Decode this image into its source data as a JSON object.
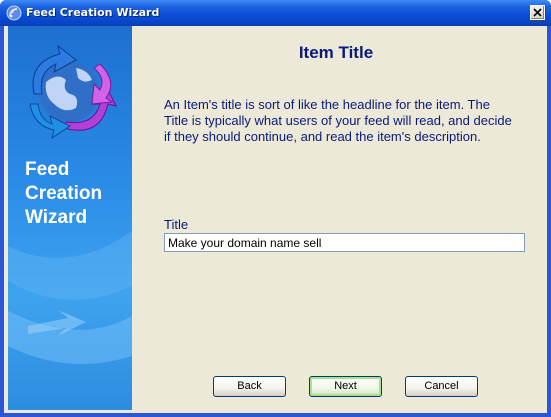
{
  "window": {
    "title": "Feed Creation Wizard",
    "icon": "rss-feed-icon",
    "close_icon": "close-icon"
  },
  "sidebar": {
    "title_lines": [
      "Feed",
      "Creation",
      "Wizard"
    ],
    "logo_icon": "globe-arrows-icon"
  },
  "page": {
    "heading": "Item Title",
    "description": "An Item's title is sort of like the headline for the item. The Title is typically what users of your feed will read, and decide if they should continue, and read the item's description."
  },
  "form": {
    "title_label": "Title",
    "title_value": "Make your domain name sell"
  },
  "buttons": {
    "back": "Back",
    "next": "Next",
    "cancel": "Cancel"
  },
  "colors": {
    "titlebar": "#0a4ed6",
    "heading_text": "#0a1a78",
    "dialog_bg": "#ece9d8",
    "sidebar": "#2a8be6"
  }
}
